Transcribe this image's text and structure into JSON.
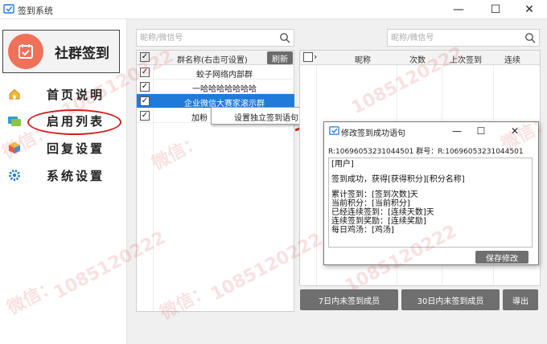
{
  "window": {
    "title": "签到系统",
    "btn_minimize": "—",
    "btn_maximize": "☐",
    "btn_close": "✕"
  },
  "sidebar": {
    "sign_button": "社群签到",
    "items": [
      {
        "label": "首页说明",
        "icon": "home-icon"
      },
      {
        "label": "启用列表",
        "icon": "group-icon"
      },
      {
        "label": "回复设置",
        "icon": "cube-icon"
      },
      {
        "label": "系统设置",
        "icon": "gear-icon"
      }
    ]
  },
  "group_panel": {
    "search_placeholder": "昵称/微信号",
    "header_name": "群名称(右击可设置)",
    "refresh_label": "刷新",
    "rows": [
      {
        "name": "蛟子网络内部群",
        "checked": "✓"
      },
      {
        "name": "一哈哈哈哈哈哈哈",
        "checked": "✓"
      },
      {
        "name": "企业微信大赛家滚示群",
        "checked": "✓"
      },
      {
        "name": "加粉",
        "checked": "✓"
      }
    ]
  },
  "context_menu": {
    "item": "设置独立签到语句"
  },
  "member_panel": {
    "search_placeholder": "昵称/微信号",
    "headers": {
      "nickname": "昵称",
      "count": "次数",
      "last_sign": "上次签到",
      "streak": "连续"
    }
  },
  "dialog": {
    "title": "修改签到成功语句",
    "btn_minimize": "—",
    "btn_maximize": "☐",
    "btn_close": "✕",
    "ids": "R:10696053231044501  群号：R:10696053231044501",
    "lines": [
      "[用户]",
      "",
      "签到成功，获得[获得积分][积分名称]",
      "",
      "累计签到：[签到次数]天",
      "当前积分：[当前积分]",
      "已经连续签到：[连续天数]天",
      "连续签到奖励：[连续奖励]",
      "每日鸡汤：[鸡汤]"
    ],
    "save_label": "保存修改"
  },
  "bottom_buttons": {
    "seven_day": "7日内未签到成员",
    "thirty_day": "30日内未签到成员",
    "export": "導出"
  },
  "watermark": {
    "wechat": "微信：",
    "number": "1085120222"
  },
  "colors": {
    "accent": "#1f7ad8",
    "sign_circle": "#f07159",
    "highlight_ring": "#d02020",
    "arrow": "#d02020"
  }
}
